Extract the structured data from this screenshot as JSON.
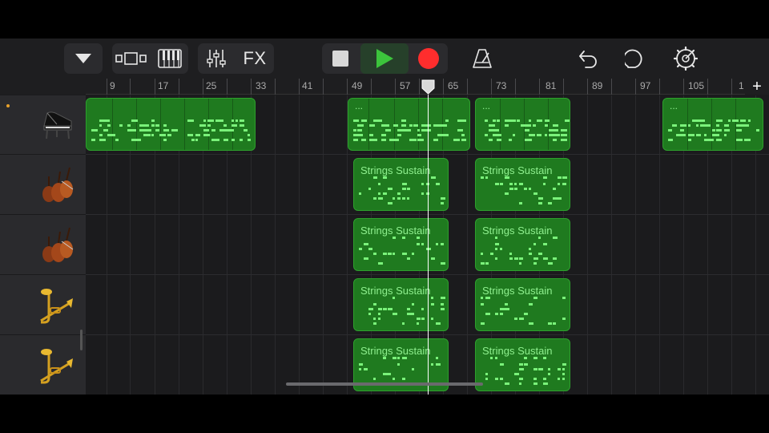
{
  "toolbar": {
    "fx_label": "FX",
    "buttons": [
      {
        "name": "tracks-menu-icon"
      },
      {
        "name": "browser-view-icon"
      },
      {
        "name": "keyboard-icon"
      },
      {
        "name": "mixer-icon"
      },
      {
        "name": "fx-button"
      },
      {
        "name": "stop-icon"
      },
      {
        "name": "play-icon"
      },
      {
        "name": "record-icon"
      },
      {
        "name": "metronome-icon"
      },
      {
        "name": "undo-icon"
      },
      {
        "name": "loop-browser-icon"
      },
      {
        "name": "settings-icon"
      }
    ],
    "colors": {
      "play": "#3cc43c",
      "record": "#ff2d2d",
      "accent": "#e8a12a"
    }
  },
  "ruler": {
    "labels": [
      "9",
      "17",
      "25",
      "33",
      "41",
      "49",
      "57",
      "65",
      "73",
      "81",
      "89",
      "97",
      "105",
      "1"
    ],
    "add_label": "+"
  },
  "tracks": [
    {
      "instrument": "grand-piano-icon",
      "record_enabled": true
    },
    {
      "instrument": "strings-icon"
    },
    {
      "instrument": "strings-icon"
    },
    {
      "instrument": "brass-icon"
    },
    {
      "instrument": "brass-icon"
    }
  ],
  "regions": [
    {
      "track": 0,
      "label": "",
      "dots": ""
    },
    {
      "track": 0,
      "label": "",
      "dots": "..."
    },
    {
      "track": 0,
      "label": "",
      "dots": "..."
    },
    {
      "track": 0,
      "label": "",
      "dots": "..."
    },
    {
      "track": 1,
      "label": "Strings Sustain"
    },
    {
      "track": 1,
      "label": "Strings Sustain"
    },
    {
      "track": 2,
      "label": "Strings Sustain"
    },
    {
      "track": 2,
      "label": "Strings Sustain"
    },
    {
      "track": 3,
      "label": "Strings Sustain"
    },
    {
      "track": 3,
      "label": "Strings Sustain"
    },
    {
      "track": 4,
      "label": "Strings Sustain"
    },
    {
      "track": 4,
      "label": "Strings Sustain"
    }
  ]
}
